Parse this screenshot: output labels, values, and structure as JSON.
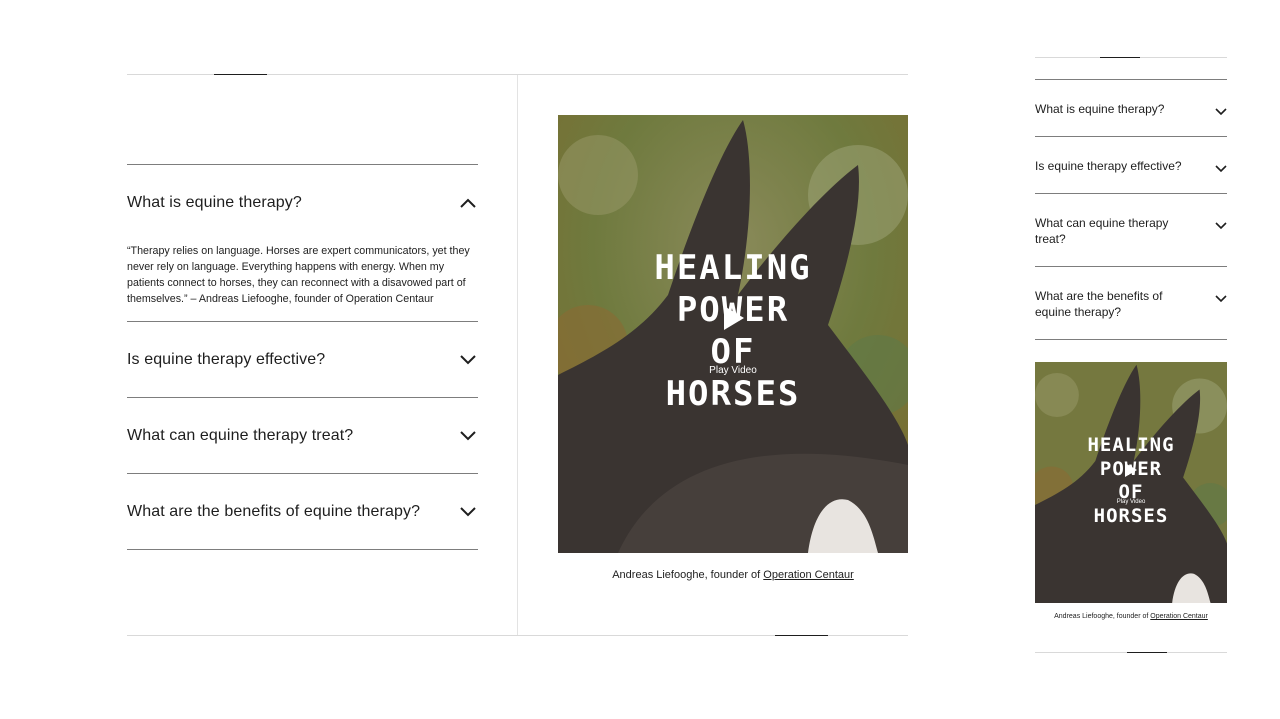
{
  "faq": {
    "items": [
      {
        "question": "What is equine therapy?",
        "answer": "“Therapy relies on language. Horses are expert communicators, yet they never rely on language. Everything happens with energy. When my patients connect to horses, they can reconnect with a disavowed part of themselves.” – Andreas Liefooghe, founder of Operation Centaur",
        "expanded": true
      },
      {
        "question": "Is equine therapy effective?",
        "expanded": false
      },
      {
        "question": "What can equine therapy treat?",
        "expanded": false
      },
      {
        "question": "What are the benefits of equine therapy?",
        "expanded": false
      }
    ]
  },
  "video": {
    "title_lines": [
      "HEALING",
      "POWER",
      "OF",
      "HORSES"
    ],
    "play_label": "Play Video",
    "caption_prefix": "Andreas Liefooghe, founder of ",
    "caption_link": "Operation Centaur"
  },
  "icons": {
    "expanded": "chevron-up-icon",
    "collapsed": "chevron-down-icon",
    "play": "play-icon"
  },
  "colors": {
    "text": "#1e1e1e",
    "divider": "#7d7d7d",
    "light_divider": "#d9d9d9"
  }
}
